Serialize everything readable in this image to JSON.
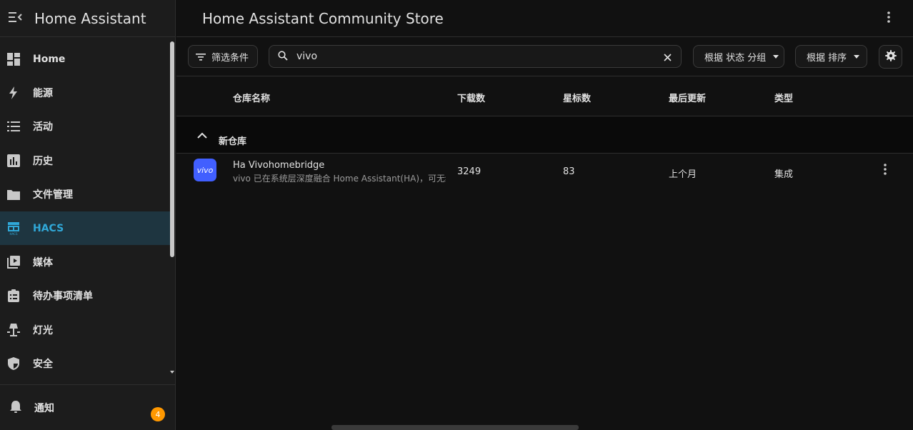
{
  "app": {
    "title": "Home Assistant"
  },
  "sidebar": {
    "items": [
      {
        "label": "Home",
        "icon": "dashboard-icon"
      },
      {
        "label": "能源",
        "icon": "lightning-icon"
      },
      {
        "label": "活动",
        "icon": "list-icon"
      },
      {
        "label": "历史",
        "icon": "chart-icon"
      },
      {
        "label": "文件管理",
        "icon": "folder-icon"
      },
      {
        "label": "HACS",
        "icon": "hacs-store-icon",
        "active": true
      },
      {
        "label": "媒体",
        "icon": "media-icon"
      },
      {
        "label": "待办事项清单",
        "icon": "clipboard-icon"
      },
      {
        "label": "灯光",
        "icon": "lamp-icon"
      },
      {
        "label": "安全",
        "icon": "shield-icon"
      }
    ],
    "footer": {
      "label": "通知",
      "badge": "4",
      "icon": "bell-icon"
    }
  },
  "main": {
    "title": "Home Assistant Community Store",
    "toolbar": {
      "filter_label": "筛选条件",
      "search_value": "vivo",
      "group_label": "根据 状态 分组",
      "sort_label": "根据 排序"
    },
    "columns": [
      "仓库名称",
      "下载数",
      "星标数",
      "最后更新",
      "类型"
    ],
    "group": {
      "label": "新仓库"
    },
    "rows": [
      {
        "logo_text": "vivo",
        "name": "Ha Vivohomebridge",
        "description": "vivo 已在系统层深度融合 Home Assistant(HA)，可无缝",
        "downloads": "3249",
        "stars": "83",
        "updated": "上个月",
        "type": "集成"
      }
    ]
  },
  "colors": {
    "accent": "#30a8d8",
    "active_bg": "#1e3540",
    "badge": "#ff9800",
    "logo_bg": "#415fff"
  }
}
